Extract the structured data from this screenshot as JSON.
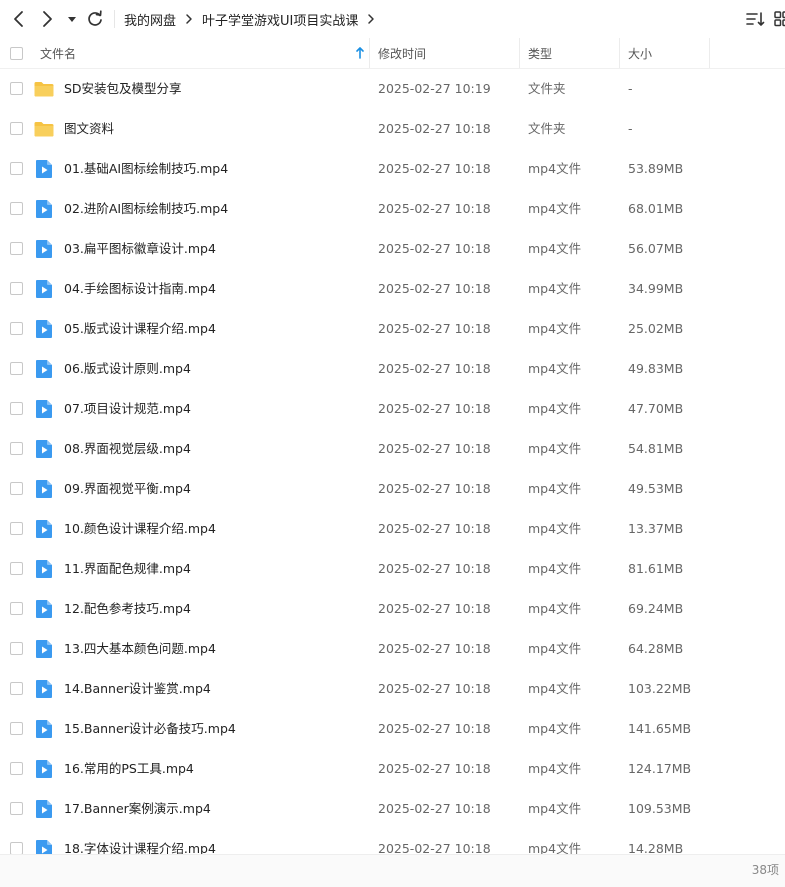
{
  "toolbar": {
    "breadcrumb": [
      "我的网盘",
      "叶子学堂游戏UI项目实战课"
    ]
  },
  "header": {
    "name": "文件名",
    "modified": "修改时间",
    "type": "类型",
    "size": "大小"
  },
  "files": [
    {
      "kind": "folder",
      "name": "SD安装包及模型分享",
      "date": "2025-02-27 10:19",
      "type": "文件夹",
      "size": "-"
    },
    {
      "kind": "folder",
      "name": "图文资料",
      "date": "2025-02-27 10:18",
      "type": "文件夹",
      "size": "-"
    },
    {
      "kind": "video",
      "name": "01.基础AI图标绘制技巧.mp4",
      "date": "2025-02-27 10:18",
      "type": "mp4文件",
      "size": "53.89MB"
    },
    {
      "kind": "video",
      "name": "02.进阶AI图标绘制技巧.mp4",
      "date": "2025-02-27 10:18",
      "type": "mp4文件",
      "size": "68.01MB"
    },
    {
      "kind": "video",
      "name": "03.扁平图标徽章设计.mp4",
      "date": "2025-02-27 10:18",
      "type": "mp4文件",
      "size": "56.07MB"
    },
    {
      "kind": "video",
      "name": "04.手绘图标设计指南.mp4",
      "date": "2025-02-27 10:18",
      "type": "mp4文件",
      "size": "34.99MB"
    },
    {
      "kind": "video",
      "name": "05.版式设计课程介绍.mp4",
      "date": "2025-02-27 10:18",
      "type": "mp4文件",
      "size": "25.02MB"
    },
    {
      "kind": "video",
      "name": "06.版式设计原则.mp4",
      "date": "2025-02-27 10:18",
      "type": "mp4文件",
      "size": "49.83MB"
    },
    {
      "kind": "video",
      "name": "07.项目设计规范.mp4",
      "date": "2025-02-27 10:18",
      "type": "mp4文件",
      "size": "47.70MB"
    },
    {
      "kind": "video",
      "name": "08.界面视觉层级.mp4",
      "date": "2025-02-27 10:18",
      "type": "mp4文件",
      "size": "54.81MB"
    },
    {
      "kind": "video",
      "name": "09.界面视觉平衡.mp4",
      "date": "2025-02-27 10:18",
      "type": "mp4文件",
      "size": "49.53MB"
    },
    {
      "kind": "video",
      "name": "10.颜色设计课程介绍.mp4",
      "date": "2025-02-27 10:18",
      "type": "mp4文件",
      "size": "13.37MB"
    },
    {
      "kind": "video",
      "name": "11.界面配色规律.mp4",
      "date": "2025-02-27 10:18",
      "type": "mp4文件",
      "size": "81.61MB"
    },
    {
      "kind": "video",
      "name": "12.配色参考技巧.mp4",
      "date": "2025-02-27 10:18",
      "type": "mp4文件",
      "size": "69.24MB"
    },
    {
      "kind": "video",
      "name": "13.四大基本颜色问题.mp4",
      "date": "2025-02-27 10:18",
      "type": "mp4文件",
      "size": "64.28MB"
    },
    {
      "kind": "video",
      "name": "14.Banner设计鉴赏.mp4",
      "date": "2025-02-27 10:18",
      "type": "mp4文件",
      "size": "103.22MB"
    },
    {
      "kind": "video",
      "name": "15.Banner设计必备技巧.mp4",
      "date": "2025-02-27 10:18",
      "type": "mp4文件",
      "size": "141.65MB"
    },
    {
      "kind": "video",
      "name": "16.常用的PS工具.mp4",
      "date": "2025-02-27 10:18",
      "type": "mp4文件",
      "size": "124.17MB"
    },
    {
      "kind": "video",
      "name": "17.Banner案例演示.mp4",
      "date": "2025-02-27 10:18",
      "type": "mp4文件",
      "size": "109.53MB"
    },
    {
      "kind": "video",
      "name": "18.字体设计课程介绍.mp4",
      "date": "2025-02-27 10:18",
      "type": "mp4文件",
      "size": "14.28MB"
    }
  ],
  "footer": {
    "count": "38项"
  },
  "colors": {
    "folder": "#f6c343",
    "video": "#3b9af0",
    "accent": "#1a8fe3"
  }
}
